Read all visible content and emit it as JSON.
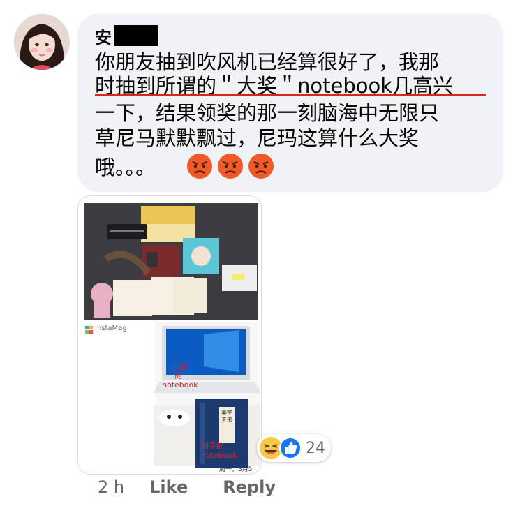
{
  "comment": {
    "author": "安",
    "lines": [
      "你朋友抽到吹风机已经算很好了，我那",
      "时抽到所谓的＂大奖＂notebook几高兴",
      "一下，结果领奖的那一刻脑海中无限只",
      "草尼马默默飘过，尼玛这算什么大奖",
      "哦。。。"
    ],
    "emoji": [
      "angry-face-icon",
      "angry-face-icon",
      "angry-face-icon"
    ]
  },
  "attachment": {
    "brand_label": "InstaMag",
    "caption_expected_1": "心想",
    "caption_expected_2": "的",
    "caption_expected_3": "notebook",
    "caption_received_1": "到手的",
    "caption_received_2": "notebook",
    "notebook_title": "美字天书",
    "date_stamp": "周一，3月5"
  },
  "reactions": {
    "icons": [
      "laughing-face-icon",
      "like-icon"
    ],
    "count": "24"
  },
  "meta": {
    "time": "2 h",
    "like_label": "Like",
    "reply_label": "Reply"
  },
  "colors": {
    "bubble_bg": "#f0f2f5",
    "text": "#050505",
    "meta_text": "#65676b",
    "underline_red": "#e0231c",
    "like_blue": "#1877f2",
    "emoji_red": "#f05a28"
  }
}
